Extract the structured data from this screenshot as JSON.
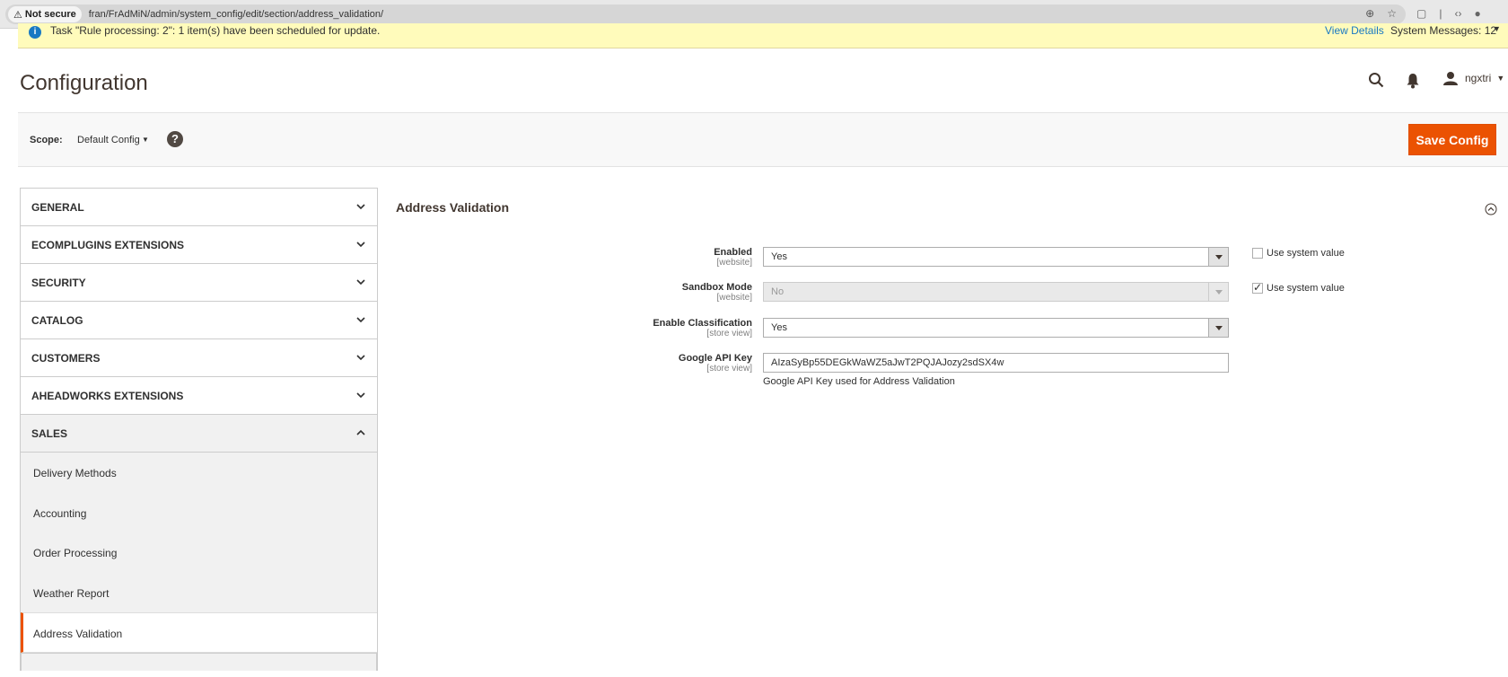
{
  "browser": {
    "security_label": "Not secure",
    "url": "fran/FrAdMiN/admin/system_config/edit/section/address_validation/"
  },
  "system_messages": {
    "message": "Task \"Rule processing: 2\": 1 item(s) have been scheduled for update.",
    "view_details": "View Details",
    "system_messages_label": "System Messages: 12"
  },
  "header": {
    "title": "Configuration",
    "user_name": "ngxtri"
  },
  "scope": {
    "label": "Scope:",
    "value": "Default Config",
    "help": "?"
  },
  "toolbar": {
    "save_label": "Save Config"
  },
  "sidebar": {
    "sections": [
      {
        "label": "GENERAL"
      },
      {
        "label": "ECOMPLUGINS EXTENSIONS"
      },
      {
        "label": "SECURITY"
      },
      {
        "label": "CATALOG"
      },
      {
        "label": "CUSTOMERS"
      },
      {
        "label": "AHEADWORKS EXTENSIONS"
      },
      {
        "label": "SALES"
      }
    ],
    "sales_items": [
      {
        "label": "Delivery Methods"
      },
      {
        "label": "Accounting"
      },
      {
        "label": "Order Processing"
      },
      {
        "label": "Weather Report"
      },
      {
        "label": "Address Validation"
      }
    ]
  },
  "main": {
    "section_title": "Address Validation",
    "fields": [
      {
        "label": "Enabled",
        "scope": "[website]",
        "value": "Yes",
        "use_system_value": "Use system value"
      },
      {
        "label": "Sandbox Mode",
        "scope": "[website]",
        "value": "No",
        "use_system_value": "Use system value"
      },
      {
        "label": "Enable Classification",
        "scope": "[store view]",
        "value": "Yes"
      },
      {
        "label": "Google API Key",
        "scope": "[store view]",
        "value": "AIzaSyBp55DEGkWaWZ5aJwT2PQJAJozy2sdSX4w",
        "note": "Google API Key used for Address Validation"
      }
    ]
  }
}
